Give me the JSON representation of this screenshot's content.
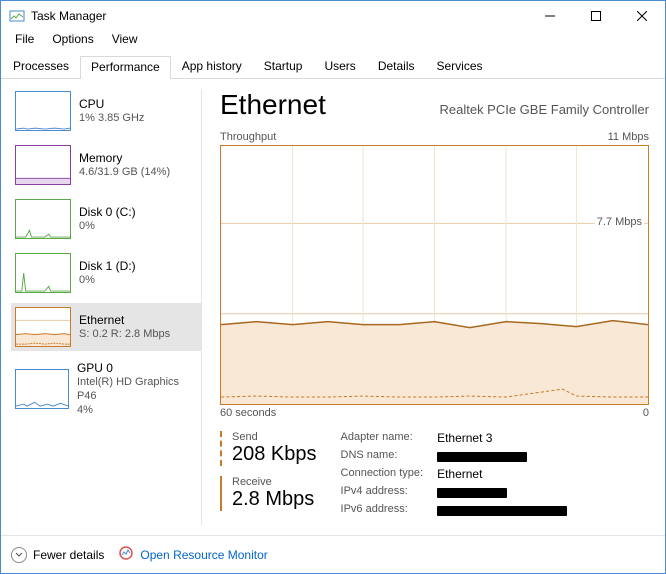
{
  "window_title": "Task Manager",
  "menu": {
    "file": "File",
    "options": "Options",
    "view": "View"
  },
  "tabs": {
    "processes": "Processes",
    "performance": "Performance",
    "app_history": "App history",
    "startup": "Startup",
    "users": "Users",
    "details": "Details",
    "services": "Services"
  },
  "sidebar": [
    {
      "title": "CPU",
      "sub": "1% 3.85 GHz",
      "color": "#4a8ad0"
    },
    {
      "title": "Memory",
      "sub": "4.6/31.9 GB (14%)",
      "color": "#8b3fa0"
    },
    {
      "title": "Disk 0 (C:)",
      "sub": "0%",
      "color": "#5da84a"
    },
    {
      "title": "Disk 1 (D:)",
      "sub": "0%",
      "color": "#5da84a"
    },
    {
      "title": "Ethernet",
      "sub": "S: 0.2 R: 2.8 Mbps",
      "color": "#c97a2b"
    },
    {
      "title": "GPU 0",
      "sub": "Intel(R) HD Graphics P46",
      "sub2": "4%",
      "color": "#4a8ad0"
    }
  ],
  "main": {
    "title": "Ethernet",
    "device": "Realtek PCIe GBE Family Controller",
    "y_label": "Throughput",
    "y_max": "11 Mbps",
    "grid_label": "7.7 Mbps",
    "x_left": "60 seconds",
    "x_right": "0",
    "send_label": "Send",
    "send_value": "208 Kbps",
    "recv_label": "Receive",
    "recv_value": "2.8 Mbps",
    "info": {
      "adapter_label": "Adapter name:",
      "adapter_value": "Ethernet 3",
      "dns_label": "DNS name:",
      "conn_label": "Connection type:",
      "conn_value": "Ethernet",
      "ipv4_label": "IPv4 address:",
      "ipv6_label": "IPv6 address:"
    }
  },
  "footer": {
    "fewer": "Fewer details",
    "resmon": "Open Resource Monitor"
  },
  "chart_data": {
    "type": "line",
    "title": "Ethernet Throughput",
    "xlabel": "60 seconds → 0",
    "ylabel": "Throughput",
    "ylim": [
      0,
      11
    ],
    "gridlines_y": [
      3.85,
      7.7
    ],
    "x": [
      0,
      5,
      10,
      15,
      20,
      25,
      30,
      35,
      40,
      45,
      50,
      55,
      60
    ],
    "series": [
      {
        "name": "Receive",
        "style": "solid",
        "values": [
          3.4,
          3.5,
          3.4,
          3.5,
          3.4,
          3.4,
          3.5,
          3.3,
          3.5,
          3.4,
          3.3,
          3.5,
          3.4
        ]
      },
      {
        "name": "Send",
        "style": "dashed",
        "values": [
          0.3,
          0.35,
          0.3,
          0.3,
          0.35,
          0.3,
          0.3,
          0.35,
          0.3,
          0.5,
          0.35,
          0.3,
          0.3
        ]
      }
    ]
  }
}
